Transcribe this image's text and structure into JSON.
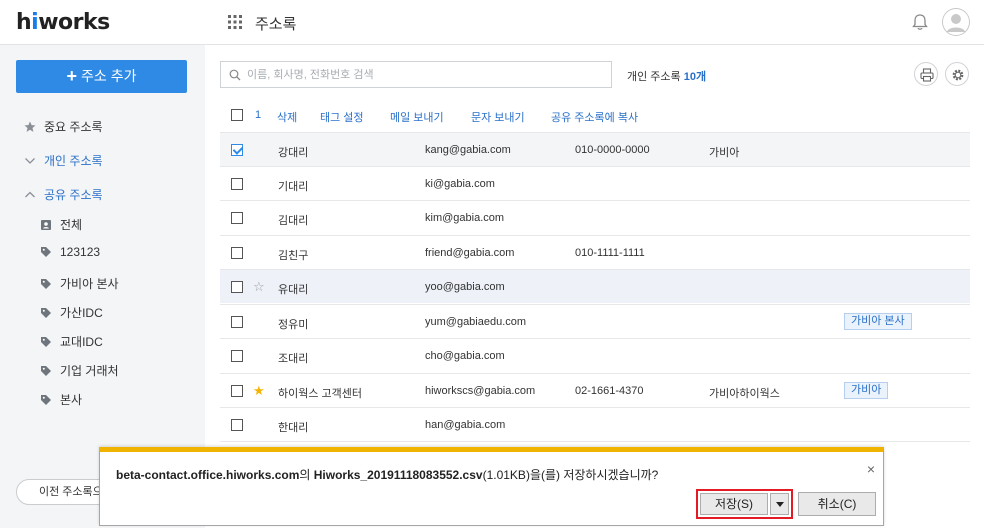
{
  "header": {
    "logo": {
      "prefix": "h",
      "dot_i": "i",
      "rest": "works"
    },
    "app_title": "주소록"
  },
  "sidebar": {
    "add_button": "주소 추가",
    "items": [
      {
        "label": "중요 주소록",
        "icon": "star-icon"
      },
      {
        "label": "개인 주소록",
        "icon": "chevron-down-icon"
      },
      {
        "label": "공유 주소록",
        "icon": "chevron-up-icon"
      }
    ],
    "shared": [
      {
        "label": "전체",
        "icon": "contact-card-icon"
      },
      {
        "label": "123123",
        "icon": "tag-icon"
      },
      {
        "label": "가비아 본사",
        "icon": "tag-icon"
      },
      {
        "label": "가산IDC",
        "icon": "tag-icon"
      },
      {
        "label": "교대IDC",
        "icon": "tag-icon"
      },
      {
        "label": "기업 거래처",
        "icon": "tag-icon"
      },
      {
        "label": "본사",
        "icon": "tag-icon"
      }
    ],
    "prev_button": "이전 주소록으"
  },
  "search": {
    "placeholder": "이름, 회사명, 전화번호 검색"
  },
  "count": {
    "prefix": "개인 주소록",
    "number": "10개"
  },
  "toolbar": {
    "selected_count": "1",
    "actions": [
      "삭제",
      "태그 설정",
      "메일 보내기",
      "문자 보내기",
      "공유 주소록에 복사"
    ]
  },
  "contacts": [
    {
      "name": "강대리",
      "email": "kang@gabia.com",
      "phone": "010-0000-0000",
      "company": "가비아",
      "tag": "",
      "checked": true,
      "starred": false
    },
    {
      "name": "기대리",
      "email": "ki@gabia.com",
      "phone": "",
      "company": "",
      "tag": "",
      "checked": false,
      "starred": false
    },
    {
      "name": "김대리",
      "email": "kim@gabia.com",
      "phone": "",
      "company": "",
      "tag": "",
      "checked": false,
      "starred": false
    },
    {
      "name": "김친구",
      "email": "friend@gabia.com",
      "phone": "010-1111-1111",
      "company": "",
      "tag": "",
      "checked": false,
      "starred": false
    },
    {
      "name": "유대리",
      "email": "yoo@gabia.com",
      "phone": "",
      "company": "",
      "tag": "",
      "checked": false,
      "starred": false
    },
    {
      "name": "정유미",
      "email": "yum@gabiaedu.com",
      "phone": "",
      "company": "",
      "tag": "가비아 본사",
      "checked": false,
      "starred": false
    },
    {
      "name": "조대리",
      "email": "cho@gabia.com",
      "phone": "",
      "company": "",
      "tag": "",
      "checked": false,
      "starred": false
    },
    {
      "name": "하이웍스 고객센터",
      "email": "hiworkscs@gabia.com",
      "phone": "02-1661-4370",
      "company": "가비아하이웍스",
      "tag": "가비아",
      "checked": false,
      "starred": true
    },
    {
      "name": "한대리",
      "email": "han@gabia.com",
      "phone": "",
      "company": "",
      "tag": "",
      "checked": false,
      "starred": false
    }
  ],
  "dialog": {
    "host": "beta-contact.office.hiworks.com",
    "host_suffix": "의 ",
    "filename": "Hiworks_20191118083552.csv",
    "size": "(1.01KB)",
    "question": "을(를) 저장하시겠습니까?",
    "save_label": "저장(S)",
    "cancel_label": "취소(C)",
    "close_glyph": "×"
  }
}
